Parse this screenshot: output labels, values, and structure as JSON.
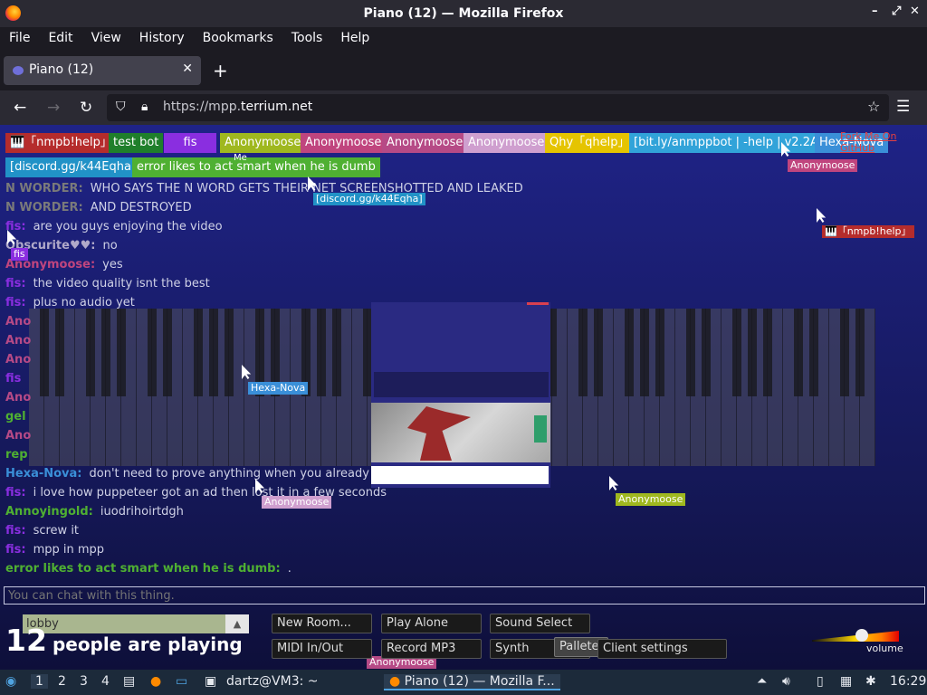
{
  "window": {
    "title": "Piano (12) — Mozilla Firefox"
  },
  "menu": [
    "File",
    "Edit",
    "View",
    "History",
    "Bookmarks",
    "Tools",
    "Help"
  ],
  "tab": {
    "title": "Piano (12)"
  },
  "url": {
    "prefix": "https://mpp.",
    "domain": "terrium.net"
  },
  "users": [
    {
      "label": "🎹「nmpb!help」",
      "color": "#b52c2c"
    },
    {
      "label": "test bot",
      "color": "#1f7f2b"
    },
    {
      "label": "fis",
      "color": "#8a2ee0"
    },
    {
      "label": "Anonymoose",
      "color": "#9fb81f"
    },
    {
      "label": "Anonymoose",
      "color": "#c0457e"
    },
    {
      "label": "Anonymoose",
      "color": "#b64a86"
    },
    {
      "label": "Anonymoose",
      "color": "#cf9fcf"
    },
    {
      "label": "Qhy「qhelp」",
      "color": "#e5c400"
    },
    {
      "label": "[bit.ly/anmppbot | -help | v2.2A]",
      "color": "#31a3d9"
    },
    {
      "label": "Hexa-Nova",
      "color": "#3a8fd8"
    },
    {
      "label": "[discord.gg/k44Eqha]",
      "color": "#2192c7"
    },
    {
      "label": "error likes to act smart when he is dumb",
      "color": "#4fb032"
    }
  ],
  "github": "Fork Me On GitHub",
  "me_label": "Me",
  "chat": [
    {
      "name": "N WORDER:",
      "msg": "WHO SAYS THE N WORD GETS THEIR NET SCREENSHOTTED AND LEAKED",
      "color": "#7a7a7a"
    },
    {
      "name": "N WORDER:",
      "msg": "AND DESTROYED",
      "color": "#7a7a7a"
    },
    {
      "name": "fis:",
      "msg": "are you guys enjoying the video",
      "color": "#8a2ee0"
    },
    {
      "name": "Obscurite♥♥:",
      "msg": "no",
      "color": "#b0a9c9"
    },
    {
      "name": "Anonymoose:",
      "msg": "yes",
      "color": "#c0457e"
    },
    {
      "name": "fis:",
      "msg": "the video quality isnt the best",
      "color": "#8a2ee0"
    },
    {
      "name": "fis:",
      "msg": "plus no audio yet",
      "color": "#8a2ee0"
    },
    {
      "name": "Hexa-Nova:",
      "msg": "don't need to prove anything when you already",
      "color": "#3a8fd8"
    },
    {
      "name": "fis:",
      "msg": "i love how puppeteer got an ad then lost it in a few seconds",
      "color": "#8a2ee0"
    },
    {
      "name": "Annoyingold:",
      "msg": "iuodrihoirtdgh",
      "color": "#4fb032"
    },
    {
      "name": "fis:",
      "msg": "screw it",
      "color": "#8a2ee0"
    },
    {
      "name": "fis:",
      "msg": "mpp in mpp",
      "color": "#8a2ee0"
    },
    {
      "name": "error likes to act smart when he is dumb:",
      "msg": ".",
      "color": "#4fb032"
    }
  ],
  "partial_names": [
    "Ano",
    "Ano",
    "Ano",
    "fis",
    "Ano",
    "gel",
    "Ano",
    "rep"
  ],
  "cursor_tags": [
    {
      "label": "fis",
      "color": "#8a2ee0"
    },
    {
      "label": "[discord.gg/k44Eqha]",
      "color": "#2192c7"
    },
    {
      "label": "Anonymoose",
      "color": "#c0457e"
    },
    {
      "label": "🎹「nmpb!help」",
      "color": "#b52c2c"
    },
    {
      "label": "Hexa-Nova",
      "color": "#3a8fd8"
    },
    {
      "label": "Anonymoose",
      "color": "#cf9fcf"
    },
    {
      "label": "Anonymoose",
      "color": "#9fb81f"
    },
    {
      "label": "Anonymoose",
      "color": "#b64a86"
    }
  ],
  "chat_input": {
    "placeholder": "You can chat with this thing."
  },
  "room": {
    "name": "lobby"
  },
  "player_count": {
    "number": "12",
    "text": "people are playing"
  },
  "buttons": {
    "new_room": "New Room...",
    "play_alone": "Play Alone",
    "sound_select": "Sound Select",
    "midi": "MIDI In/Out",
    "record": "Record MP3",
    "synth": "Synth",
    "pallete": "Pallete",
    "client_settings": "Client settings"
  },
  "volume": {
    "label": "volume",
    "level": 0.55
  },
  "taskbar": {
    "workspaces": [
      "1",
      "2",
      "3",
      "4"
    ],
    "terminal": "dartz@VM3: ~",
    "firefox": "Piano (12) — Mozilla F...",
    "clock": "16:29"
  }
}
